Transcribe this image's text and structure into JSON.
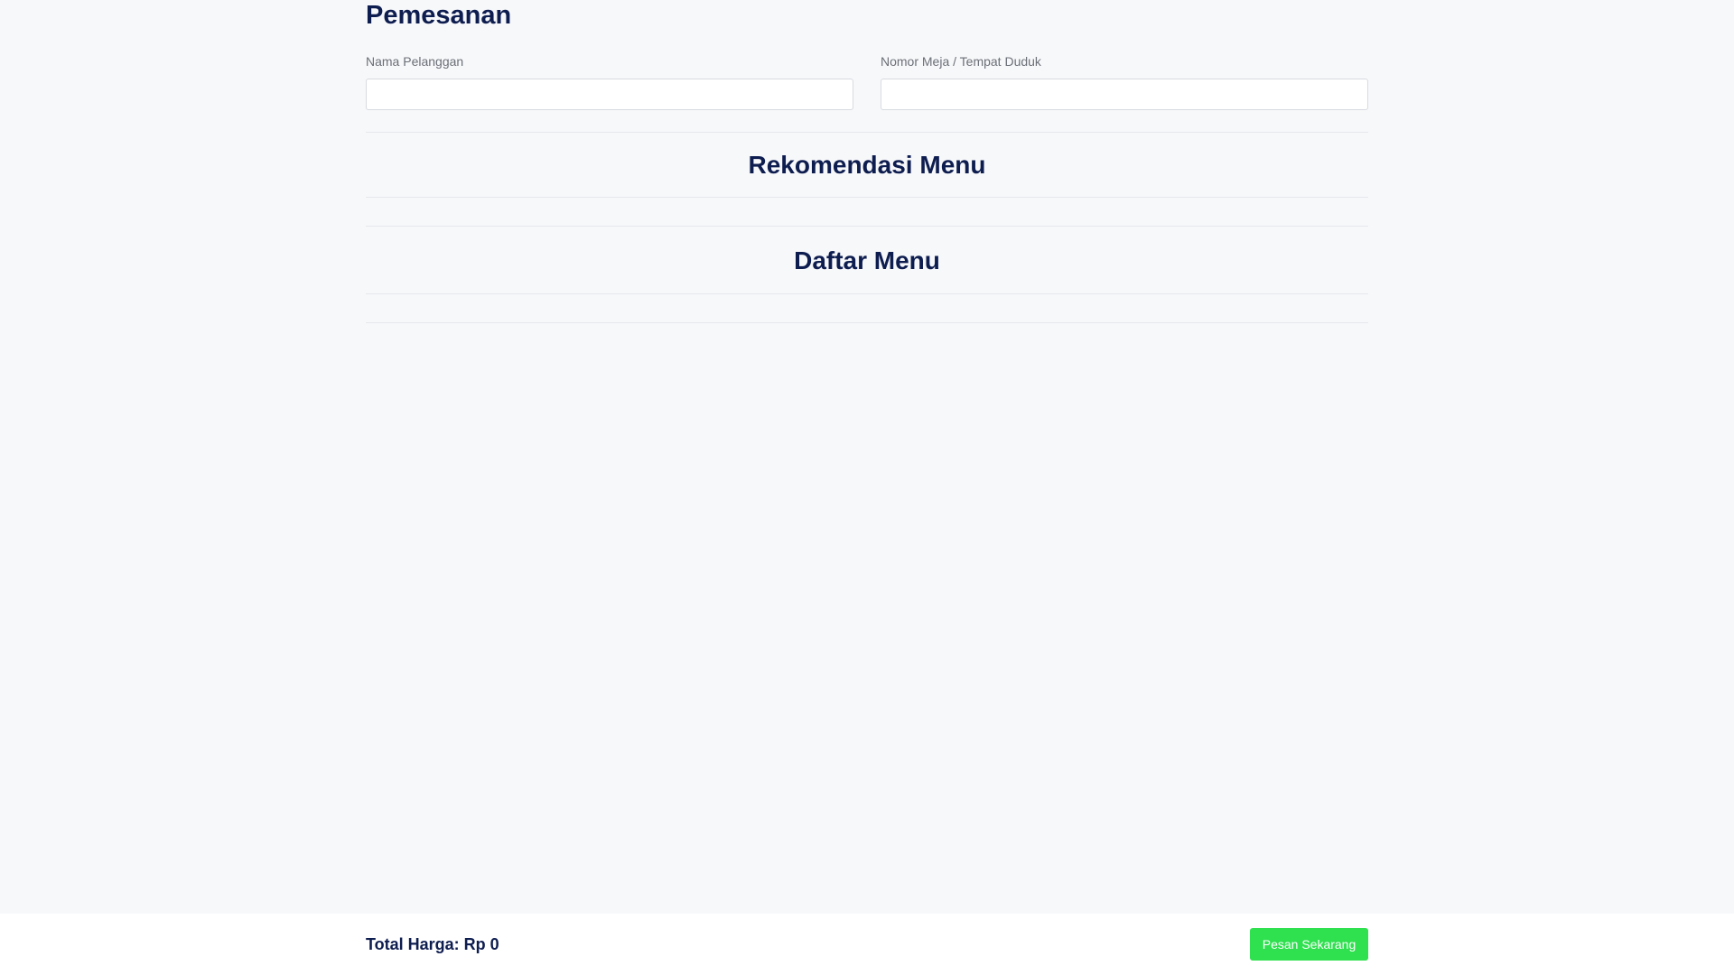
{
  "page": {
    "title": "Pemesanan"
  },
  "form": {
    "customer_name_label": "Nama Pelanggan",
    "customer_name_value": "",
    "table_label": "Nomor Meja / Tempat Duduk",
    "table_value": ""
  },
  "sections": {
    "recommendation_title": "Rekomendasi Menu",
    "menu_title": "Daftar Menu"
  },
  "footer": {
    "total_label": "Total Harga: Rp 0",
    "order_button_label": "Pesan Sekarang"
  },
  "colors": {
    "heading": "#0e1d4f",
    "accent_button": "#2fe04f",
    "background": "#f7f8fa"
  }
}
